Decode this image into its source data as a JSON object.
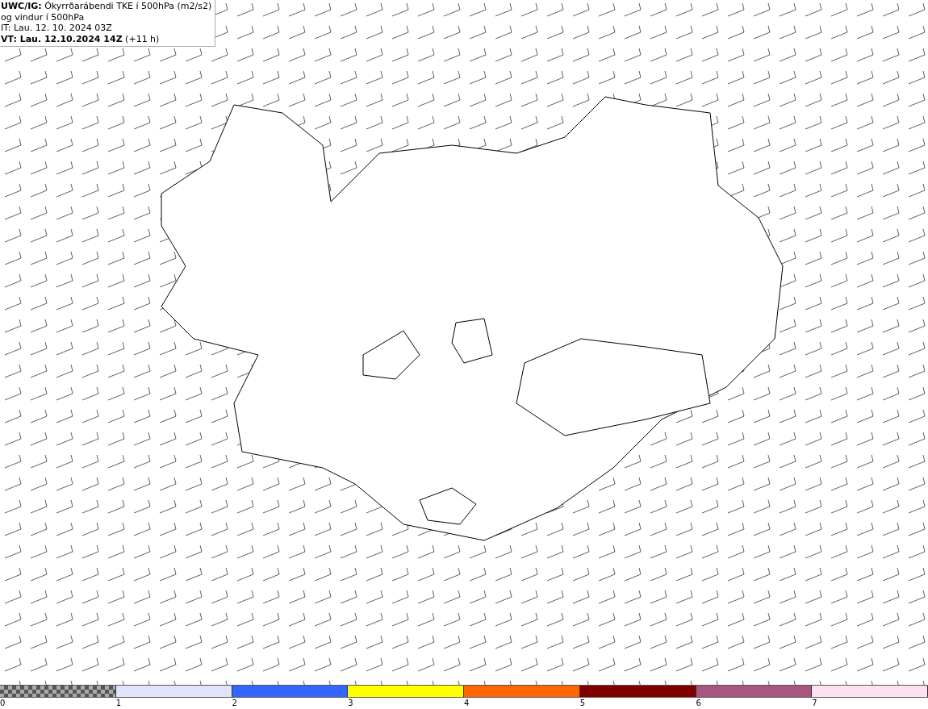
{
  "legend": {
    "lines": [
      "**UWC/IG:** Ókyrrðarábendi TKE í 500hPa (m2/s2)",
      "og vindur í 500hPa",
      "IT: Lau. 12. 10. 2024 03Z",
      "**VT: Lau. 12.10.2024 14Z** (+11 h)"
    ]
  },
  "colorbar": {
    "segments": [
      {
        "kind": "checker"
      },
      {
        "kind": "solid",
        "color": "#e0e3fa"
      },
      {
        "kind": "solid",
        "color": "#3366ff"
      },
      {
        "kind": "solid",
        "color": "#ffff00"
      },
      {
        "kind": "solid",
        "color": "#ff6600"
      },
      {
        "kind": "solid",
        "color": "#800000"
      },
      {
        "kind": "solid",
        "color": "#a85580"
      },
      {
        "kind": "solid",
        "color": "#ffe0f0"
      }
    ],
    "ticks": [
      "0",
      "1",
      "2",
      "3",
      "4",
      "5",
      "6",
      "7"
    ]
  }
}
